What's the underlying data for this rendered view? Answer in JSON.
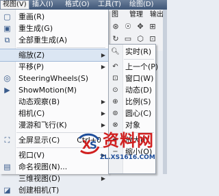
{
  "menubar": {
    "items": [
      {
        "label": "视图(V)"
      },
      {
        "label": "插入(I)"
      },
      {
        "label": "格式(O)"
      },
      {
        "label": "工具(T)"
      },
      {
        "label": "绘图(D)"
      }
    ]
  },
  "ribbon_tabs": [
    "图",
    "管理",
    "输出"
  ],
  "view_menu": {
    "items": [
      {
        "label": "重画(R)",
        "icon": "redraw-icon"
      },
      {
        "label": "重生成(G)",
        "icon": "regen-icon"
      },
      {
        "label": "全部重生成(A)",
        "icon": "regen-all-icon"
      },
      {
        "label": "缩放(Z)",
        "submenu": true
      },
      {
        "label": "平移(P)",
        "submenu": true
      },
      {
        "label": "SteeringWheels(S)",
        "icon": "steering-wheel-icon"
      },
      {
        "label": "ShowMotion(M)",
        "icon": "showmotion-icon"
      },
      {
        "label": "动态观察(B)",
        "submenu": true
      },
      {
        "label": "相机(C)",
        "submenu": true
      },
      {
        "label": "漫游和飞行(K)",
        "submenu": true
      },
      {
        "label": "全屏显示(C)",
        "shortcut": "Ctrl+0",
        "icon": "fullscreen-icon"
      },
      {
        "label": "视口(V)",
        "submenu": true
      },
      {
        "label": "命名视图(N)...",
        "icon": "named-view-icon"
      },
      {
        "label": "三维视图(D)",
        "submenu": true
      },
      {
        "label": "创建相机(T)",
        "icon": "camera-icon"
      }
    ]
  },
  "zoom_submenu": {
    "items": [
      {
        "label": "实时(R)",
        "icon": "zoom-realtime-icon"
      },
      {
        "label": "上一个(P)",
        "icon": "zoom-previous-icon"
      },
      {
        "label": "窗口(W)",
        "icon": "zoom-window-icon"
      },
      {
        "label": "动态(D)",
        "icon": "zoom-dynamic-icon"
      },
      {
        "label": "比例(S)",
        "icon": "zoom-scale-icon"
      },
      {
        "label": "圆心(C)",
        "icon": "zoom-center-icon"
      },
      {
        "label": "对象",
        "icon": "zoom-object-icon"
      },
      {
        "label": "放大(I)",
        "icon": "zoom-in-icon"
      },
      {
        "label": "缩小(O)",
        "icon": "zoom-out-icon"
      }
    ]
  },
  "watermark": {
    "text": "资料网",
    "url": "ZL.XS1616.COM"
  }
}
